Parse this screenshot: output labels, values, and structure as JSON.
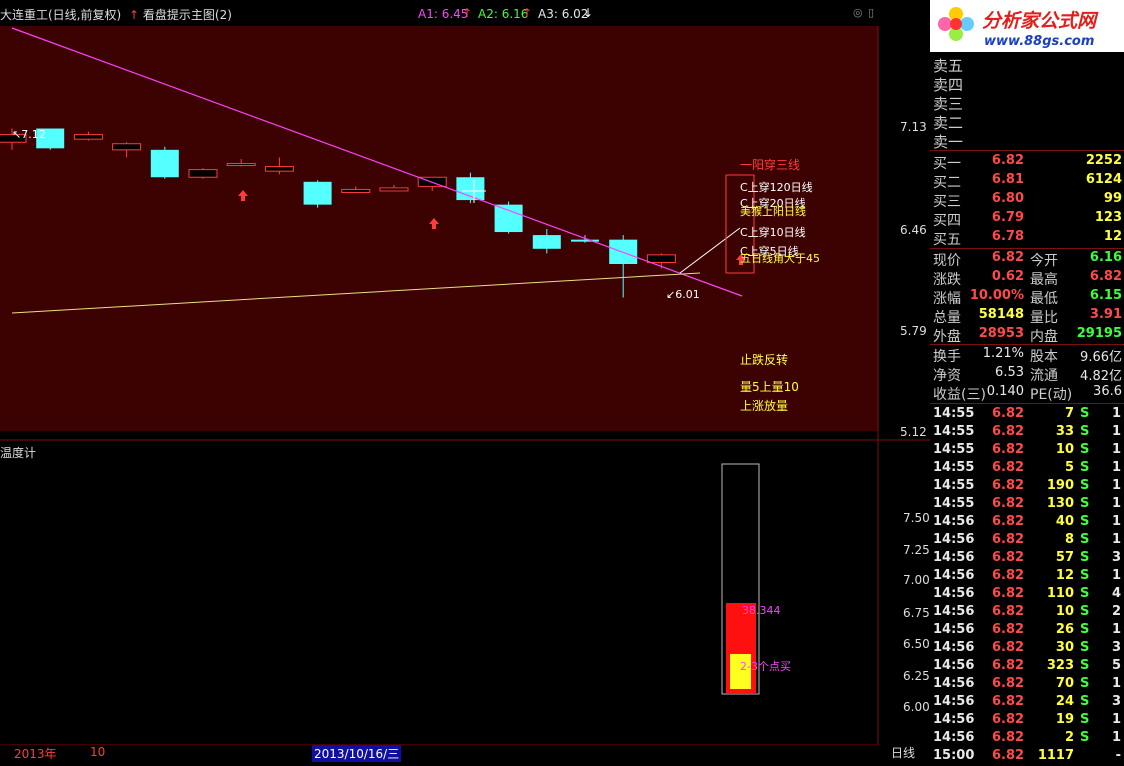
{
  "header": {
    "stock_title": "大连重工(日线,前复权)",
    "hint_label": "看盘提示主图(2)",
    "a1": "A1: 6.45",
    "a2": "A2: 6.16",
    "a3": "A3: 6.02"
  },
  "main_axis": [
    "7.13",
    "6.46",
    "5.79",
    "5.12"
  ],
  "price_marks": {
    "high": "7.12",
    "low": "6.01"
  },
  "signals": {
    "title": "一阳穿三线",
    "items": [
      "C上穿120日线",
      "C上穿20日线",
      "美猴上阳日线",
      "C上穿10日线",
      "C上穿5日线",
      "五日线角大于45"
    ],
    "stop_fall": "止跌反转",
    "vol_cross": "量5上量10",
    "rise_vol": "上涨放量"
  },
  "sub_chart": {
    "title": "温度计",
    "axis": [
      "7.50",
      "7.25",
      "7.00",
      "6.75",
      "6.50",
      "6.25",
      "6.00"
    ],
    "value": "38.344",
    "tip": "2-3个点买"
  },
  "bottom": {
    "year": "2013年",
    "month": "10",
    "date": "2013/10/16/三",
    "period": "日线"
  },
  "logo": {
    "name": "分析家公式网",
    "url": "www.88gs.com"
  },
  "orderbook": {
    "sell": [
      "卖五",
      "卖四",
      "卖三",
      "卖二",
      "卖一"
    ],
    "buy": [
      {
        "label": "买一",
        "price": "6.82",
        "vol": "2252"
      },
      {
        "label": "买二",
        "price": "6.81",
        "vol": "6124"
      },
      {
        "label": "买三",
        "price": "6.80",
        "vol": "99"
      },
      {
        "label": "买四",
        "price": "6.79",
        "vol": "123"
      },
      {
        "label": "买五",
        "price": "6.78",
        "vol": "12"
      }
    ]
  },
  "quote": [
    {
      "l1": "现价",
      "v1": "6.82",
      "c1": "red",
      "l2": "今开",
      "v2": "6.16",
      "c2": "grn"
    },
    {
      "l1": "涨跌",
      "v1": "0.62",
      "c1": "red",
      "l2": "最高",
      "v2": "6.82",
      "c2": "red"
    },
    {
      "l1": "涨幅",
      "v1": "10.00%",
      "c1": "red",
      "l2": "最低",
      "v2": "6.15",
      "c2": "grn"
    },
    {
      "l1": "总量",
      "v1": "58148",
      "c1": "yel",
      "l2": "量比",
      "v2": "3.91",
      "c2": "red"
    },
    {
      "l1": "外盘",
      "v1": "28953",
      "c1": "red",
      "l2": "内盘",
      "v2": "29195",
      "c2": "grn"
    }
  ],
  "fundamentals": [
    {
      "l1": "换手",
      "v1": "1.21%",
      "l2": "股本",
      "v2": "9.66亿"
    },
    {
      "l1": "净资",
      "v1": "6.53",
      "l2": "流通",
      "v2": "4.82亿"
    },
    {
      "l1": "收益(三)",
      "v1": "0.140",
      "l2": "PE(动)",
      "v2": "36.6"
    }
  ],
  "ticks": [
    {
      "t": "14:55",
      "p": "6.82",
      "v": "7",
      "s": "S",
      "n": "1"
    },
    {
      "t": "14:55",
      "p": "6.82",
      "v": "33",
      "s": "S",
      "n": "1"
    },
    {
      "t": "14:55",
      "p": "6.82",
      "v": "10",
      "s": "S",
      "n": "1"
    },
    {
      "t": "14:55",
      "p": "6.82",
      "v": "5",
      "s": "S",
      "n": "1"
    },
    {
      "t": "14:55",
      "p": "6.82",
      "v": "190",
      "s": "S",
      "n": "1"
    },
    {
      "t": "14:55",
      "p": "6.82",
      "v": "130",
      "s": "S",
      "n": "1"
    },
    {
      "t": "14:56",
      "p": "6.82",
      "v": "40",
      "s": "S",
      "n": "1"
    },
    {
      "t": "14:56",
      "p": "6.82",
      "v": "8",
      "s": "S",
      "n": "1"
    },
    {
      "t": "14:56",
      "p": "6.82",
      "v": "57",
      "s": "S",
      "n": "3"
    },
    {
      "t": "14:56",
      "p": "6.82",
      "v": "12",
      "s": "S",
      "n": "1"
    },
    {
      "t": "14:56",
      "p": "6.82",
      "v": "110",
      "s": "S",
      "n": "4"
    },
    {
      "t": "14:56",
      "p": "6.82",
      "v": "10",
      "s": "S",
      "n": "2"
    },
    {
      "t": "14:56",
      "p": "6.82",
      "v": "26",
      "s": "S",
      "n": "1"
    },
    {
      "t": "14:56",
      "p": "6.82",
      "v": "30",
      "s": "S",
      "n": "3"
    },
    {
      "t": "14:56",
      "p": "6.82",
      "v": "323",
      "s": "S",
      "n": "5"
    },
    {
      "t": "14:56",
      "p": "6.82",
      "v": "70",
      "s": "S",
      "n": "1"
    },
    {
      "t": "14:56",
      "p": "6.82",
      "v": "24",
      "s": "S",
      "n": "3"
    },
    {
      "t": "14:56",
      "p": "6.82",
      "v": "19",
      "s": "S",
      "n": "1"
    },
    {
      "t": "14:56",
      "p": "6.82",
      "v": "2",
      "s": "S",
      "n": "1"
    },
    {
      "t": "15:00",
      "p": "6.82",
      "v": "1117",
      "s": "",
      "n": "-"
    }
  ],
  "candles": [
    {
      "o": 7.03,
      "c": 7.08,
      "h": 7.12,
      "l": 6.98
    },
    {
      "o": 7.12,
      "c": 6.99,
      "h": 7.12,
      "l": 6.98
    },
    {
      "o": 7.05,
      "c": 7.08,
      "h": 7.1,
      "l": 7.04
    },
    {
      "o": 6.98,
      "c": 7.02,
      "h": 7.03,
      "l": 6.93
    },
    {
      "o": 6.98,
      "c": 6.8,
      "h": 7.0,
      "l": 6.79
    },
    {
      "o": 6.8,
      "c": 6.85,
      "h": 6.86,
      "l": 6.79
    },
    {
      "o": 6.88,
      "c": 6.89,
      "h": 6.92,
      "l": 6.87
    },
    {
      "o": 6.84,
      "c": 6.87,
      "h": 6.93,
      "l": 6.82
    },
    {
      "o": 6.77,
      "c": 6.62,
      "h": 6.78,
      "l": 6.6
    },
    {
      "o": 6.7,
      "c": 6.72,
      "h": 6.74,
      "l": 6.7
    },
    {
      "o": 6.71,
      "c": 6.73,
      "h": 6.75,
      "l": 6.71
    },
    {
      "o": 6.74,
      "c": 6.8,
      "h": 6.8,
      "l": 6.71
    },
    {
      "o": 6.8,
      "c": 6.65,
      "h": 6.83,
      "l": 6.63
    },
    {
      "o": 6.62,
      "c": 6.44,
      "h": 6.64,
      "l": 6.43
    },
    {
      "o": 6.42,
      "c": 6.33,
      "h": 6.46,
      "l": 6.3
    },
    {
      "o": 6.39,
      "c": 6.38,
      "h": 6.42,
      "l": 6.37
    },
    {
      "o": 6.39,
      "c": 6.23,
      "h": 6.42,
      "l": 6.01
    },
    {
      "o": 6.24,
      "c": 6.29,
      "h": 6.3,
      "l": 6.2
    }
  ],
  "colors": {
    "up": "#ff3c3c",
    "down": "#54ffff",
    "bg": "#3a0000",
    "ma": "#ff40ff",
    "support": "#e8e080"
  }
}
